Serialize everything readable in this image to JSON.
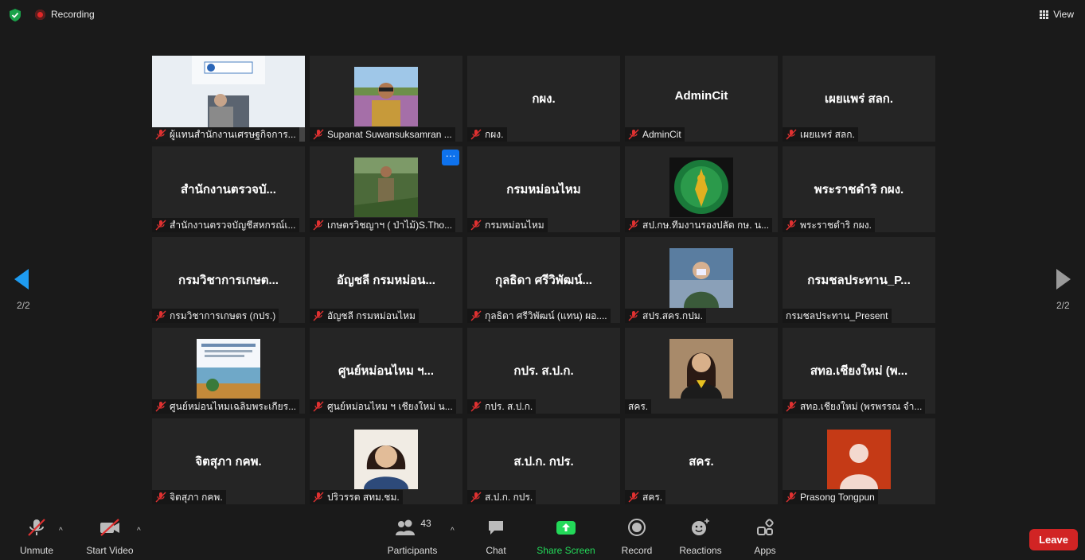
{
  "topbar": {
    "recording_label": "Recording",
    "view_label": "View"
  },
  "gallery": {
    "tiles": [
      {
        "big": "",
        "label": "ผู้แทนสำนักงานเศรษฐกิจการ...",
        "muted": true,
        "pic": "room"
      },
      {
        "big": "",
        "label": "Supanat Suwansuksamran ...",
        "muted": true,
        "pic": "field"
      },
      {
        "big": "กผง.",
        "label": "กผง.",
        "muted": true
      },
      {
        "big": "AdminCit",
        "label": "AdminCit",
        "muted": true
      },
      {
        "big": "เผยแพร่ สลก.",
        "label": "เผยแพร่ สลก.",
        "muted": true
      },
      {
        "big": "สำนักงานตรวจบั...",
        "label": "สำนักงานตรวจบัญชีสหกรณ์เ...",
        "muted": true
      },
      {
        "big": "",
        "label": "เกษตรวิชญาฯ (  ป่าไม้)S.Tho...",
        "muted": true,
        "pic": "forest",
        "more": "···"
      },
      {
        "big": "กรมหม่อนไหม",
        "label": "กรมหม่อนไหม",
        "muted": true
      },
      {
        "big": "",
        "label": "สป.กษ.ทีมงานรองปลัด กษ. น...",
        "muted": true,
        "pic": "seal"
      },
      {
        "big": "พระราชดำริ กผง.",
        "label": "พระราชดำริ กผง.",
        "muted": true
      },
      {
        "big": "กรมวิชาการเกษต...",
        "label": "กรมวิชาการเกษตร (กปร.)",
        "muted": true
      },
      {
        "big": "อัญชลี กรมหม่อน...",
        "label": "อัญชลี กรมหม่อนไหม",
        "muted": true
      },
      {
        "big": "กุลธิดา ศรีวิพัฒน์...",
        "label": "กุลธิดา ศรีวิพัฒน์ (แทน) ผอ....",
        "muted": true
      },
      {
        "big": "",
        "label": "สปร.สคร.กปม.",
        "muted": true,
        "pic": "office"
      },
      {
        "big": "กรมชลประทาน_P...",
        "label": "กรมชลประทาน_Present",
        "muted": false
      },
      {
        "big": "",
        "label": "ศูนย์หม่อนไหมเฉลิมพระเกียร...",
        "muted": true,
        "pic": "slide"
      },
      {
        "big": "ศูนย์หม่อนไหม ฯ...",
        "label": "ศูนย์หม่อนไหม ฯ เชียงใหม่ น...",
        "muted": true
      },
      {
        "big": "กปร. ส.ป.ก.",
        "label": "กปร. ส.ป.ก.",
        "muted": true
      },
      {
        "big": "",
        "label": "สคร.",
        "muted": false,
        "pic": "woman"
      },
      {
        "big": "สทอ.เชียงใหม่ (พ...",
        "label": "สทอ.เชียงใหม่ (พรพรรณ จำ...",
        "muted": true
      },
      {
        "big": "จิตสุภา กคพ.",
        "label": "จิตสุภา กคพ.",
        "muted": true
      },
      {
        "big": "",
        "label": "ปริวรรต สทม.ชม.",
        "muted": true,
        "pic": "selfie"
      },
      {
        "big": "ส.ป.ก. กปร.",
        "label": "ส.ป.ก. กปร.",
        "muted": true
      },
      {
        "big": "สคร.",
        "label": "สคร.",
        "muted": true
      },
      {
        "big": "",
        "label": "Prasong Tongpun",
        "muted": true,
        "pic": "avatar"
      }
    ]
  },
  "paging": {
    "left": "2/2",
    "right": "2/2"
  },
  "toolbar": {
    "unmute": "Unmute",
    "start_video": "Start Video",
    "participants": "Participants",
    "participants_count": "43",
    "chat": "Chat",
    "share_screen": "Share Screen",
    "record": "Record",
    "reactions": "Reactions",
    "apps": "Apps",
    "leave": "Leave"
  },
  "colors": {
    "accent_green": "#23d959",
    "leave_red": "#d12424",
    "muted_red": "#e03131",
    "tile_bg": "#252525",
    "avatar_bg": "#c53a16"
  }
}
